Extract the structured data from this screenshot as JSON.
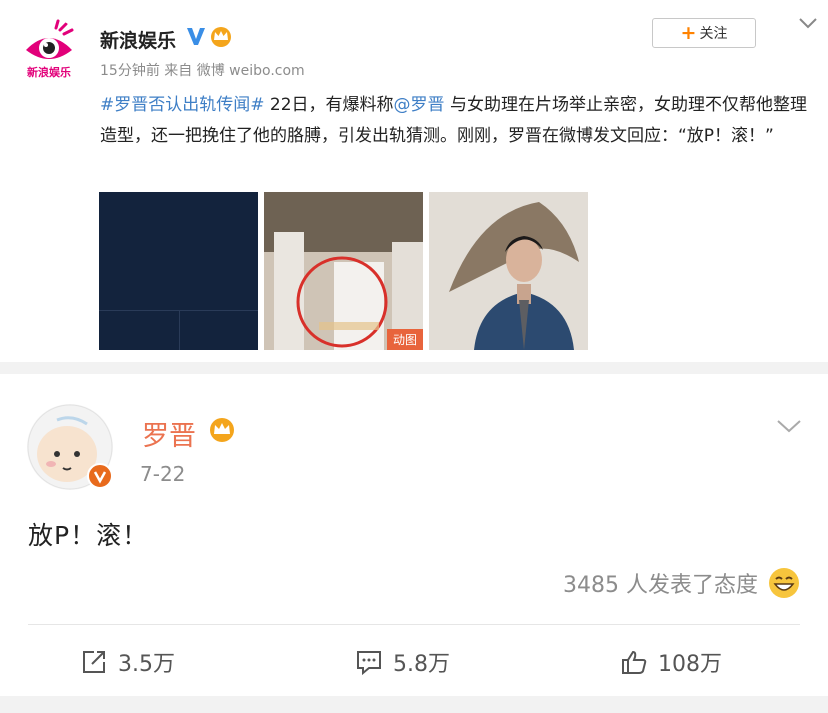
{
  "post1": {
    "author": "新浪娱乐",
    "avatar_text": "新浪娱乐",
    "meta": "15分钟前 来自 微博 weibo.com",
    "follow_label": "关注",
    "follow_plus": "+",
    "body": {
      "topic": "#罗晋否认出轨传闻#",
      "text_a": " 22日，有爆料称",
      "mention": "@罗晋",
      "text_b": " 与女助理在片场举止亲密，女助理不仅帮他整理造型，还一把挽住了他的胳膊，引发出轨猜测。刚刚，罗晋在微博发文回应：“放P！滚！”"
    },
    "gif_tag": "动图",
    "icons": {
      "verified": "verified-v-icon",
      "crown": "vip-crown-icon",
      "more": "chevron-down-icon"
    },
    "colors": {
      "link": "#3f7fc6",
      "accent": "#ff8200"
    }
  },
  "post2": {
    "author": "罗晋",
    "date": "7-22",
    "body": "放P！滚！",
    "attitude": "3485 人发表了态度",
    "actions": {
      "share": "3.5万",
      "comment": "5.8万",
      "like": "108万"
    },
    "icons": {
      "share": "share-icon",
      "comment": "comment-icon",
      "like": "thumbs-up-icon",
      "emoji": "laughing-emoji-icon"
    },
    "colors": {
      "name": "#eb7350",
      "verified": "#e86a1c"
    }
  }
}
